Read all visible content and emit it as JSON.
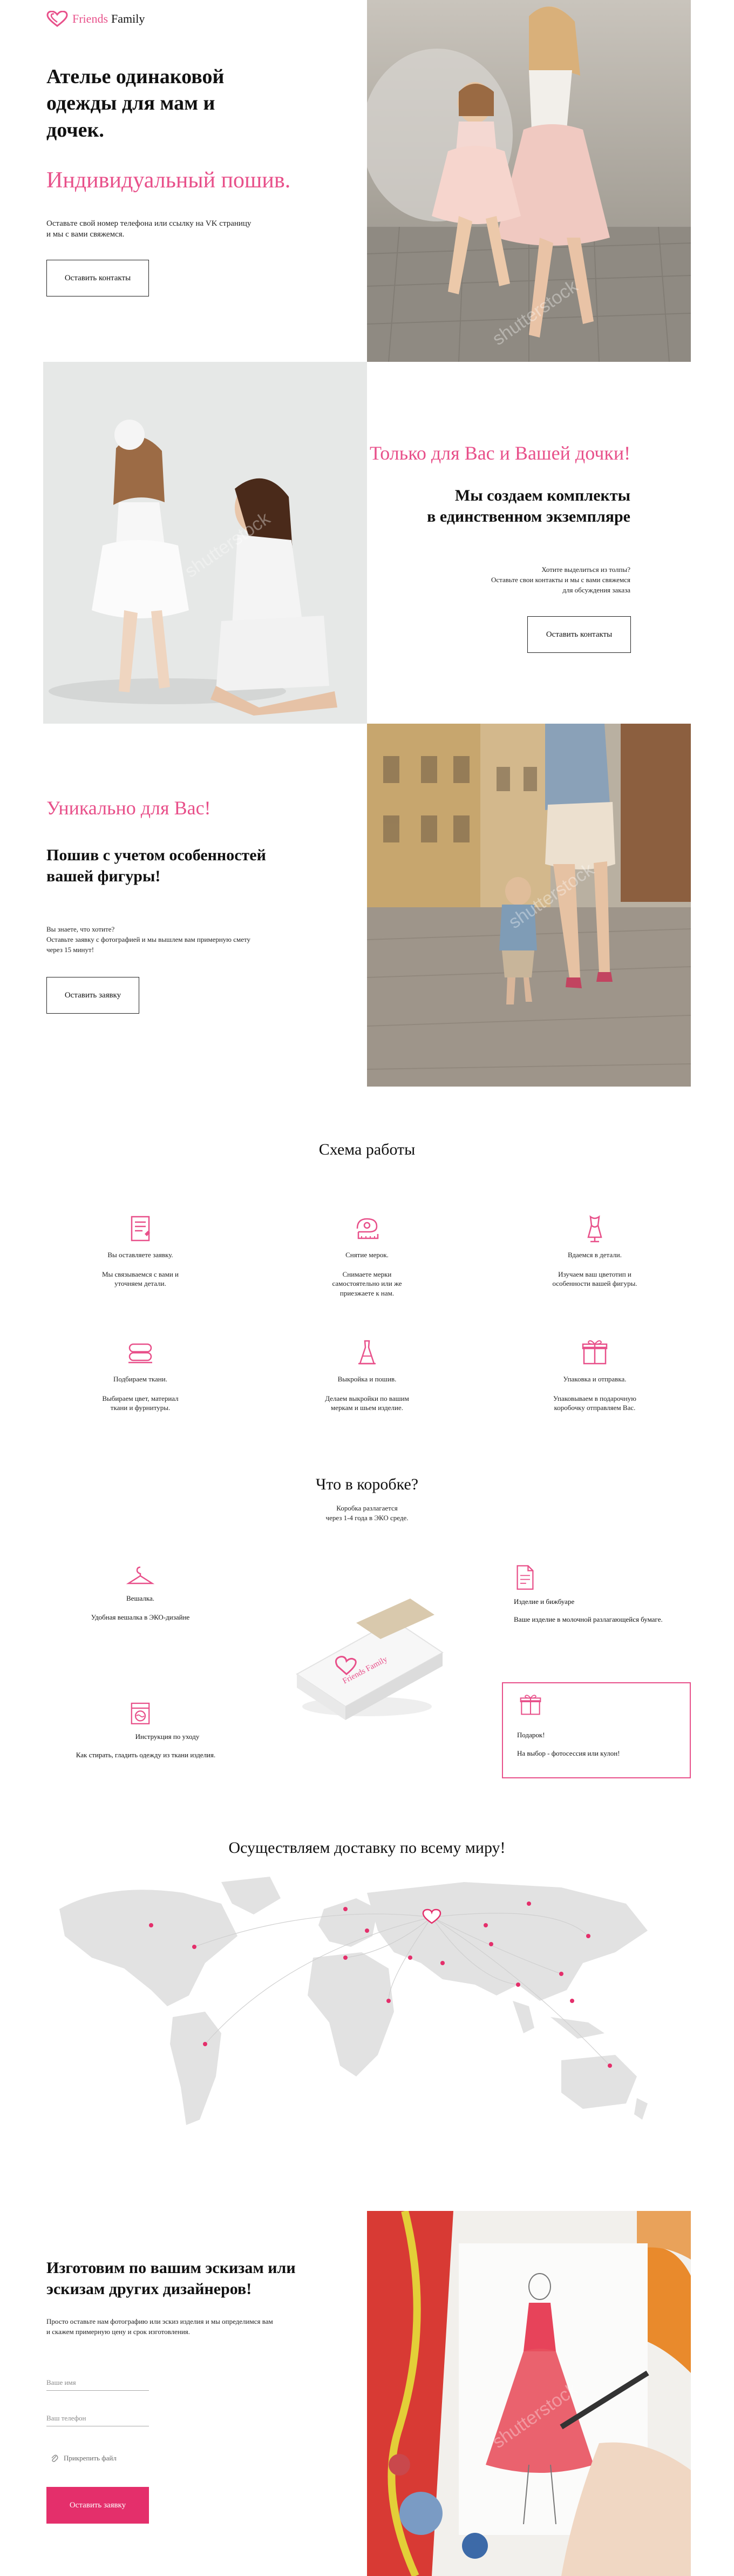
{
  "brand": {
    "friends": "Friends",
    "family": "Family"
  },
  "hero": {
    "title": "Ателье одинаковой одежды для мам и дочек.",
    "subtitle": "Индивидуальный пошив.",
    "text": "Оставьте свой номер телефона или ссылку на VK страницу и мы с вами свяжемся.",
    "button": "Оставить контакты"
  },
  "section2": {
    "accent": "Только для Вас и Вашей дочки!",
    "title_line1": "Мы создаем комплекты",
    "title_line2": "в единственном экземпляре",
    "text_line1": "Хотите выделиться из толпы?",
    "text_line2": "Оставьте свои контакты и мы с вами свяжемся",
    "text_line3": "для обсуждения заказа",
    "button": "Оставить контакты"
  },
  "section3": {
    "accent": "Уникально для Вас!",
    "title": "Пошив с учетом особенностей вашей фигуры!",
    "text_line1": "Вы знаете, что хотите?",
    "text_line2": "Оставьте заявку с фотографией и мы вышлем вам примерную смету через 15 минут!",
    "button": "Оставить заявку"
  },
  "scheme": {
    "title": "Схема работы",
    "steps": [
      {
        "title": "Вы оставляете заявку.",
        "text": "Мы связываемся с вами и уточняем детали.",
        "icon": "form-icon"
      },
      {
        "title": "Снятие мерок.",
        "text": "Снимаете мерки самостоятельно или же приезжаете к нам.",
        "icon": "measuring-tape-icon"
      },
      {
        "title": "Вдаемся в детали.",
        "text": "Изучаем ваш цветотип и особенности вашей фигуры.",
        "icon": "mannequin-icon"
      },
      {
        "title": "Подбираем ткани.",
        "text": "Выбираем цвет, материал ткани и фурнитуры.",
        "icon": "fabric-roll-icon"
      },
      {
        "title": "Выкройка и пошив.",
        "text": "Делаем выкройки по вашим меркам и шьем изделие.",
        "icon": "dress-icon"
      },
      {
        "title": "Упаковка и отправка.",
        "text": "Упаковываем в подарочную коробочку отправляем Вас.",
        "icon": "gift-box-icon"
      }
    ]
  },
  "box": {
    "title": "Что в коробке?",
    "subtitle_line1": "Коробка разлагается",
    "subtitle_line2": "через 1-4 года в ЭКО среде.",
    "items": [
      {
        "title": "Вешалка.",
        "text": "Удобная вешалка в ЭКО-дизайне",
        "icon": "hanger-icon"
      },
      {
        "title": "Изделие и бижбуаре",
        "text": "Ваше изделие в молочной разлагающейся бумаге.",
        "icon": "document-icon"
      },
      {
        "title": "Инструкция по уходу",
        "text": "Как стирать, гладить одежду из ткани изделия.",
        "icon": "washing-icon"
      },
      {
        "title": "Подарок!",
        "text": "На выбор - фотосессия или кулон!",
        "icon": "gift-icon"
      }
    ],
    "box_brand": "Friends Family"
  },
  "delivery": {
    "title": "Осуществляем доставку по всему миру!"
  },
  "sketch": {
    "title": "Изготовим по вашим эскизам или эскизам других дизайнеров!",
    "text": "Просто оставьте нам фотографию или эскиз изделия и мы определимся вам и скажем примерную цену и срок изготовления.",
    "name_placeholder": "Ваше имя",
    "phone_placeholder": "Ваш телефон",
    "attach": "Прикрепить файл",
    "button": "Оставить заявку"
  },
  "watermark": "shutterstock",
  "colors": {
    "accent": "#e8508a",
    "button": "#e42f6b",
    "map": "#e2e2e2"
  }
}
